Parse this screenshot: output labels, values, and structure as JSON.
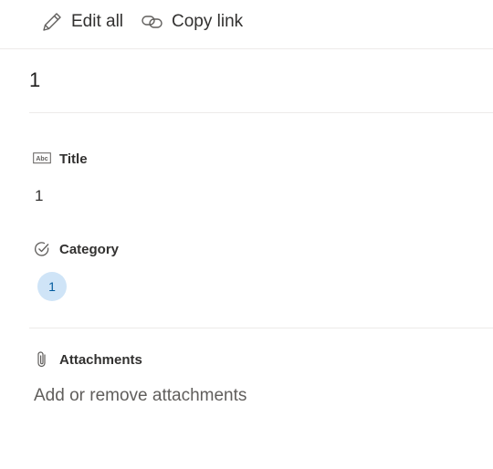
{
  "toolbar": {
    "edit_all_label": "Edit all",
    "edit_icon": "pencil-icon",
    "copy_link_label": "Copy link",
    "copy_icon": "link-icon"
  },
  "item": {
    "title": "1"
  },
  "fields": {
    "title": {
      "label": "Title",
      "icon": "text-field-icon",
      "value": "1"
    },
    "category": {
      "label": "Category",
      "icon": "choice-check-icon",
      "value": "1",
      "pill_color": "#cfe4f7",
      "pill_text_color": "#005a9e"
    },
    "attachments": {
      "label": "Attachments",
      "icon": "paperclip-icon",
      "action": "Add or remove attachments"
    }
  }
}
